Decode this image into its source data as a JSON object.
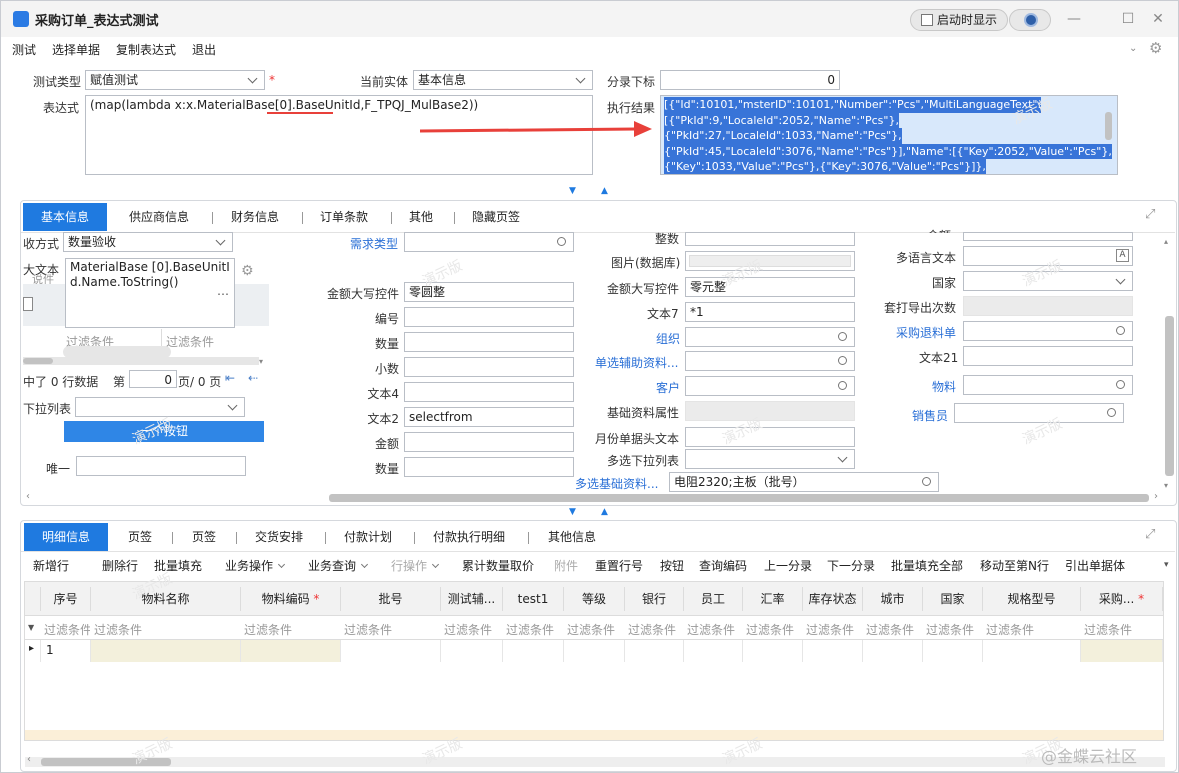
{
  "window": {
    "title": "采购订单_表达式测试",
    "startup_label": "启动时显示"
  },
  "menu": [
    "测试",
    "选择单据",
    "复制表达式",
    "退出"
  ],
  "top": {
    "test_type_label": "测试类型",
    "test_type_value": "赋值测试",
    "required_mark": "*",
    "entity_label": "当前实体",
    "entity_value": "基本信息",
    "index_label": "分录下标",
    "index_value": "0",
    "expr_label": "表达式",
    "expr_value": "(map(lambda x:x.MaterialBase[0].BaseUnitId,F_TPQJ_MulBase2))",
    "result_label": "执行结果",
    "result_lines": [
      "[{\"Id\":10101,\"msterID\":10101,\"Number\":\"Pcs\",\"MultiLanguageText\":",
      "[{\"PkId\":9,\"LocaleId\":2052,\"Name\":\"Pcs\"},",
      "{\"PkId\":27,\"LocaleId\":1033,\"Name\":\"Pcs\"},",
      "{\"PkId\":45,\"LocaleId\":3076,\"Name\":\"Pcs\"}],\"Name\":[{\"Key\":2052,\"Value\":\"Pcs\"},",
      "{\"Key\":1033,\"Value\":\"Pcs\"},{\"Key\":3076,\"Value\":\"Pcs\"}]},"
    ]
  },
  "tabs1": [
    "基本信息",
    "供应商信息",
    "财务信息",
    "订单条款",
    "其他",
    "隐藏页签"
  ],
  "panel1": {
    "c1": {
      "receive_label": "收方式",
      "receive_value": "数量验收",
      "bigtext_label": "大文本",
      "bigtext_value": "MaterialBase [0].BaseUnitId.Name.ToString()",
      "bigtext_behind": "说件",
      "filter1": "过滤条件",
      "filter2": "过滤条件",
      "paging_prefix": "中了 0 行数据",
      "page_label": "第",
      "page_value": "0",
      "page_suffix": "页/ 0 页",
      "dropdown_label": "下拉列表",
      "button_label": "一个按钮",
      "unique_label": "唯一"
    },
    "c2": {
      "demand_label": "需求类型",
      "fields": [
        {
          "label": "金额大写控件",
          "value": "零圆整"
        },
        {
          "label": "编号",
          "value": ""
        },
        {
          "label": "数量",
          "value": ""
        },
        {
          "label": "小数",
          "value": ""
        },
        {
          "label": "文本4",
          "value": ""
        },
        {
          "label": "文本2",
          "value": "selectfrom"
        },
        {
          "label": "金额",
          "value": ""
        },
        {
          "label": "数量",
          "value": ""
        }
      ]
    },
    "c3": {
      "int_label": "整数",
      "image_label": "图片(数据库)",
      "amount_label": "金额大写控件",
      "amount_value": "零元整",
      "text7_label": "文本7",
      "text7_value": "*1",
      "org_label": "组织",
      "single_label": "单选辅助资料...",
      "customer_label": "客户",
      "basic_attr_label": "基础资料属性",
      "month_label": "月份单据头文本",
      "multi_dd_label": "多选下拉列表",
      "multi_basic_label": "多选基础资料...",
      "multi_basic_value": "电阻2320;主板（批号）"
    },
    "c4": {
      "money_label": "金额",
      "multi_lang_label": "多语言文本",
      "country_label": "国家",
      "print_label": "套打导出次数",
      "return_label": "采购退料单",
      "text21_label": "文本21",
      "material_label": "物料",
      "seller_label": "销售员"
    }
  },
  "tabs2": [
    "明细信息",
    "页签",
    "页签",
    "交货安排",
    "付款计划",
    "付款执行明细",
    "其他信息"
  ],
  "toolbar": [
    "新增行",
    "删除行",
    "批量填充",
    "业务操作",
    "业务查询",
    "行操作",
    "累计数量取价",
    "附件",
    "重置行号",
    "按钮",
    "查询编码",
    "上一分录",
    "下一分录",
    "批量填充全部",
    "移动至第N行",
    "引出单据体"
  ],
  "grid": {
    "headers": [
      "序号",
      "物料名称",
      "物料编码",
      "批号",
      "测试辅...",
      "test1",
      "等级",
      "银行",
      "员工",
      "汇率",
      "库存状态",
      "城市",
      "国家",
      "规格型号",
      "采购..."
    ],
    "filter": "过滤条件",
    "row1": "1"
  },
  "watermark": "演示版",
  "brand": "@金蝶云社区",
  "colors": {
    "accent": "#1f7ae0",
    "link": "#2a6fd6",
    "arrow": "#e8403a"
  }
}
